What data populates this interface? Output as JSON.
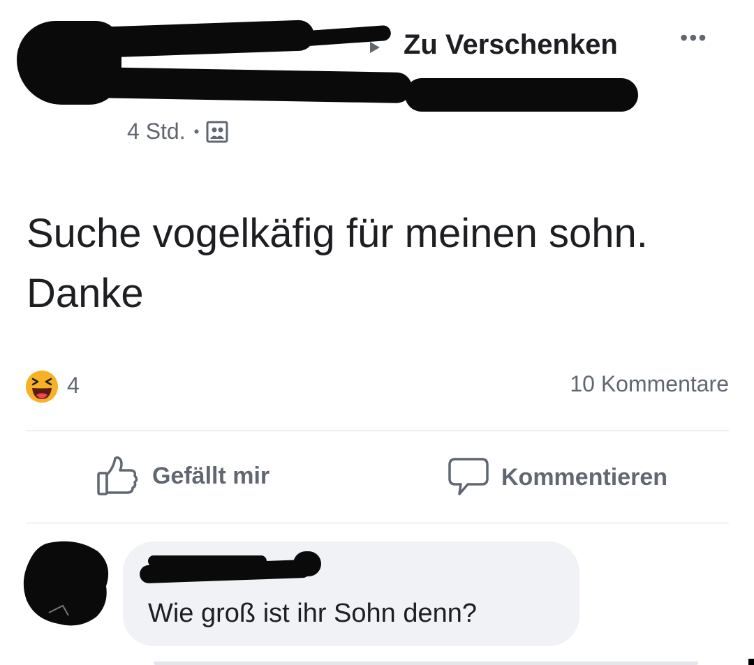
{
  "post": {
    "group_name": "Zu Verschenken",
    "time": "4 Std.",
    "separator": "•",
    "more": "•••",
    "text": "Suche vogelkäfig für meinen sohn. Danke"
  },
  "stats": {
    "reaction_icon": "haha-icon",
    "reaction_count": "4",
    "comments": "10 Kommentare"
  },
  "actions": {
    "like": "Gefällt mir",
    "comment": "Kommentieren"
  },
  "comment": {
    "text": "Wie groß ist ihr Sohn denn?"
  },
  "colors": {
    "muted": "#606770",
    "bubble": "#f0f2f5",
    "divider": "#dadde1",
    "emoji_face": "#f7b125"
  }
}
